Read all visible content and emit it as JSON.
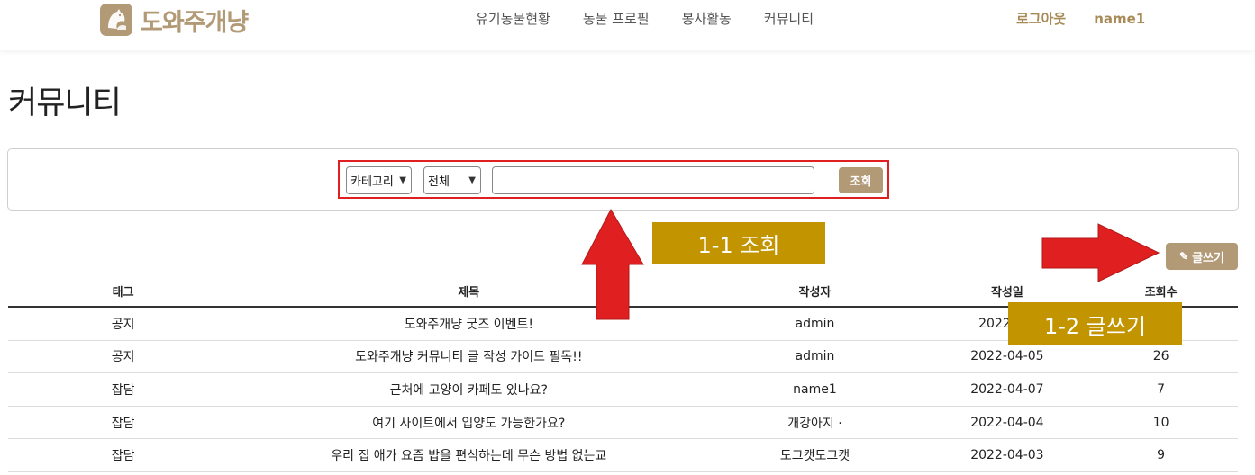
{
  "header": {
    "logo_text": "도와주개냥",
    "nav": [
      "유기동물현황",
      "동물 프로필",
      "봉사활동",
      "커뮤니티"
    ],
    "logout": "로그아웃",
    "username": "name1"
  },
  "page": {
    "title": "커뮤니티"
  },
  "search": {
    "category_select": "카테고리",
    "scope_select": "전체",
    "input_value": "",
    "button": "조회"
  },
  "annotations": {
    "search_label": "1-1 조회",
    "write_label": "1-2 글쓰기",
    "accent_color": "#c29400",
    "arrow_color": "#e02020"
  },
  "write_button": "글쓰기",
  "table": {
    "headers": {
      "tag": "태그",
      "title": "제목",
      "author": "작성자",
      "date": "작성일",
      "views": "조회수"
    },
    "rows": [
      {
        "tag": "공지",
        "title": "도와주개냥 굿즈 이벤트!",
        "author": "admin",
        "date": "2022-04-",
        "views": ""
      },
      {
        "tag": "공지",
        "title": "도와주개냥 커뮤니티 글 작성 가이드 필독!!",
        "author": "admin",
        "date": "2022-04-05",
        "views": "26"
      },
      {
        "tag": "잡담",
        "title": "근처에 고양이 카페도 있나요?",
        "author": "name1",
        "date": "2022-04-07",
        "views": "7"
      },
      {
        "tag": "잡담",
        "title": "여기 사이트에서 입양도 가능한가요?",
        "author": "개강아지 ·",
        "date": "2022-04-04",
        "views": "10"
      },
      {
        "tag": "잡담",
        "title": "우리 집 애가 요즘 밥을 편식하는데 무슨 방법 없는교",
        "author": "도그캣도그캣",
        "date": "2022-04-03",
        "views": "9"
      }
    ]
  },
  "brand_color": "#b39a77"
}
